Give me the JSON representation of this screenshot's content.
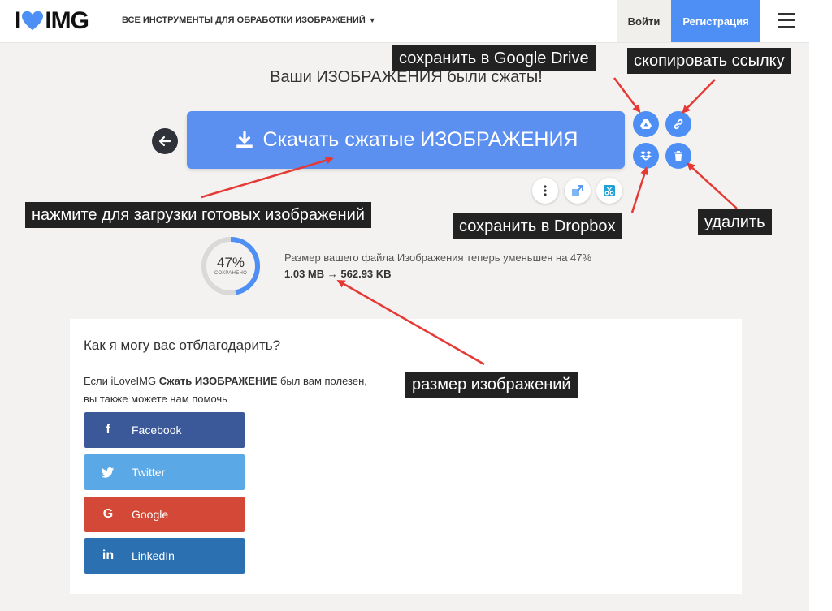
{
  "header": {
    "logo_left": "I",
    "logo_right": "IMG",
    "tools_menu": "ВСЕ ИНСТРУМЕНТЫ ДЛЯ ОБРАБОТКИ ИЗОБРАЖЕНИЙ",
    "login": "Войти",
    "register": "Регистрация"
  },
  "main": {
    "title": "Ваши ИЗОБРАЖЕНИЯ были сжаты!",
    "download_label": "Скачать сжатые ИЗОБРАЖЕНИЯ",
    "saved_percent": "47%",
    "saved_fraction": 0.47,
    "saved_label": "СОХРАНЕНО",
    "size_text": "Размер вашего файла Изображения теперь уменьшен на 47%",
    "size_before": "1.03 MB",
    "size_after": "562.93 KB"
  },
  "panel": {
    "title": "Как я могу вас отблагодарить?",
    "text_prefix": "Если iLoveIMG ",
    "text_bold": "Сжать ИЗОБРАЖЕНИЕ",
    "text_suffix": " был вам полезен,",
    "text_line2": "вы также можете нам помочь",
    "social": [
      {
        "label": "Facebook",
        "color": "#3b5998"
      },
      {
        "label": "Twitter",
        "color": "#5aa9e6"
      },
      {
        "label": "Google",
        "color": "#d34836"
      },
      {
        "label": "LinkedIn",
        "color": "#2b70b0"
      }
    ]
  },
  "annotations": {
    "google_drive": "сохранить в Google Drive",
    "copy_link": "скопировать ссылку",
    "download_hint": "нажмите для загрузки готовых изображений",
    "dropbox": "сохранить в Dropbox",
    "delete": "удалить",
    "size": "размер изображений"
  },
  "colors": {
    "accent": "#4d8ff4",
    "download": "#5b8ff0",
    "annotation_arrow": "#e53935"
  }
}
